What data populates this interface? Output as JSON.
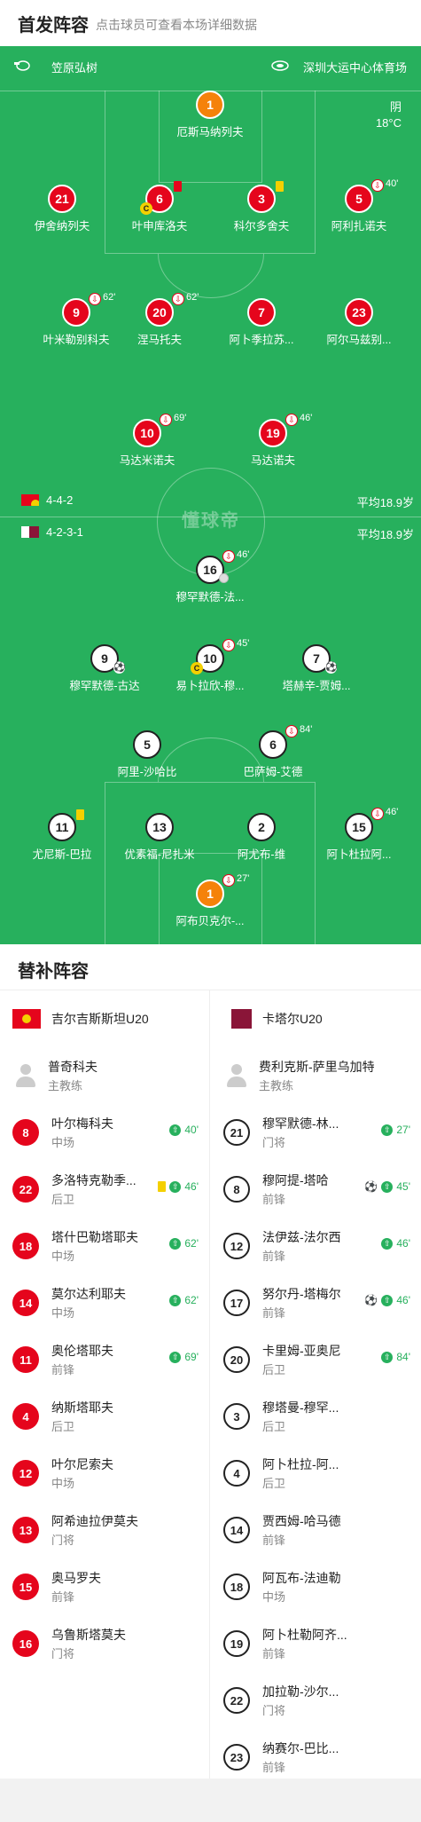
{
  "header": {
    "title": "首发阵容",
    "hint": "点击球员可查看本场详细数据"
  },
  "match": {
    "referee": "笠原弘树",
    "venue": "深圳大运中心体育场",
    "weather": "阴",
    "temperature": "18°C",
    "watermark": "懂球帝"
  },
  "home": {
    "formation": "4-4-2",
    "avg_age": "平均18.9岁",
    "flag_color": "#e5051c"
  },
  "away": {
    "formation": "4-2-3-1",
    "avg_age": "平均18.9岁",
    "flag_color": "#8a1538"
  },
  "home_players": [
    {
      "number": "1",
      "name": "厄斯马纳列夫",
      "style": "orange"
    },
    {
      "number": "21",
      "name": "伊舍纳列夫",
      "style": "red"
    },
    {
      "number": "6",
      "name": "叶申库洛夫",
      "style": "red",
      "card": "red",
      "captain": "C"
    },
    {
      "number": "3",
      "name": "科尔多舍夫",
      "style": "red",
      "card": "yellow"
    },
    {
      "number": "5",
      "name": "阿利扎诺夫",
      "style": "red",
      "sub_time": "40'"
    },
    {
      "number": "9",
      "name": "叶米勒别科夫",
      "style": "red",
      "sub_time": "62'"
    },
    {
      "number": "20",
      "name": "涅马托夫",
      "style": "red",
      "sub_time": "62'"
    },
    {
      "number": "7",
      "name": "阿卜季拉苏...",
      "style": "red"
    },
    {
      "number": "23",
      "name": "阿尔马兹别...",
      "style": "red"
    },
    {
      "number": "10",
      "name": "马达米诺夫",
      "style": "red",
      "sub_time": "69'"
    },
    {
      "number": "19",
      "name": "马达诺夫",
      "style": "red",
      "sub_time": "46'"
    }
  ],
  "away_players": [
    {
      "number": "16",
      "name": "穆罕默德-法...",
      "style": "white",
      "sub_time": "46'"
    },
    {
      "number": "9",
      "name": "穆罕默德-古达",
      "style": "white"
    },
    {
      "number": "10",
      "name": "易卜拉欣-穆...",
      "style": "white",
      "sub_time": "45'",
      "captain": "C"
    },
    {
      "number": "7",
      "name": "塔赫辛-贾姆...",
      "style": "white"
    },
    {
      "number": "5",
      "name": "阿里-沙哈比",
      "style": "white"
    },
    {
      "number": "6",
      "name": "巴萨姆-艾德",
      "style": "white",
      "sub_time": "84'"
    },
    {
      "number": "11",
      "name": "尤尼斯-巴拉",
      "style": "white",
      "card": "yellow"
    },
    {
      "number": "13",
      "name": "优素福-尼扎米",
      "style": "white"
    },
    {
      "number": "2",
      "name": "阿尤布-维",
      "style": "white"
    },
    {
      "number": "15",
      "name": "阿卜杜拉阿...",
      "style": "white",
      "sub_time": "46'"
    },
    {
      "number": "1",
      "name": "阿布贝克尔-...",
      "style": "orange",
      "sub_time": "27'"
    }
  ],
  "subs": {
    "title": "替补阵容",
    "home": {
      "team": "吉尔吉斯斯坦U20",
      "coach": {
        "name": "普奇科夫",
        "role": "主教练"
      },
      "players": [
        {
          "number": "8",
          "name": "叶尔梅科夫",
          "pos": "中场",
          "sub_time": "40'"
        },
        {
          "number": "22",
          "name": "多洛特克勒季...",
          "pos": "后卫",
          "sub_time": "46'",
          "card": "yellow"
        },
        {
          "number": "18",
          "name": "塔什巴勒塔耶夫",
          "pos": "中场",
          "sub_time": "62'"
        },
        {
          "number": "14",
          "name": "莫尔达利耶夫",
          "pos": "中场",
          "sub_time": "62'"
        },
        {
          "number": "11",
          "name": "奥伦塔耶夫",
          "pos": "前锋",
          "sub_time": "69'"
        },
        {
          "number": "4",
          "name": "纳斯塔耶夫",
          "pos": "后卫"
        },
        {
          "number": "12",
          "name": "叶尔尼索夫",
          "pos": "中场"
        },
        {
          "number": "13",
          "name": "阿希迪拉伊莫夫",
          "pos": "门将"
        },
        {
          "number": "15",
          "name": "奥马罗夫",
          "pos": "前锋"
        },
        {
          "number": "16",
          "name": "乌鲁斯塔莫夫",
          "pos": "门将"
        }
      ]
    },
    "away": {
      "team": "卡塔尔U20",
      "coach": {
        "name": "费利克斯-萨里乌加特",
        "role": "主教练"
      },
      "players": [
        {
          "number": "21",
          "name": "穆罕默德-林...",
          "pos": "门将",
          "sub_time": "27'"
        },
        {
          "number": "8",
          "name": "穆阿提-塔哈",
          "pos": "前锋",
          "sub_time": "45'",
          "goal": true
        },
        {
          "number": "12",
          "name": "法伊兹-法尔西",
          "pos": "前锋",
          "sub_time": "46'"
        },
        {
          "number": "17",
          "name": "努尔丹-塔梅尔",
          "pos": "前锋",
          "sub_time": "46'",
          "goal": true
        },
        {
          "number": "20",
          "name": "卡里姆-亚奥尼",
          "pos": "后卫",
          "sub_time": "84'"
        },
        {
          "number": "3",
          "name": "穆塔曼-穆罕...",
          "pos": "后卫"
        },
        {
          "number": "4",
          "name": "阿卜杜拉-阿...",
          "pos": "后卫"
        },
        {
          "number": "14",
          "name": "贾西姆-哈马德",
          "pos": "前锋"
        },
        {
          "number": "18",
          "name": "阿瓦布-法迪勒",
          "pos": "中场"
        },
        {
          "number": "19",
          "name": "阿卜杜勒阿齐...",
          "pos": "前锋"
        },
        {
          "number": "22",
          "name": "加拉勒-沙尔...",
          "pos": "门将"
        },
        {
          "number": "23",
          "name": "纳赛尔-巴比...",
          "pos": "前锋"
        }
      ]
    }
  }
}
